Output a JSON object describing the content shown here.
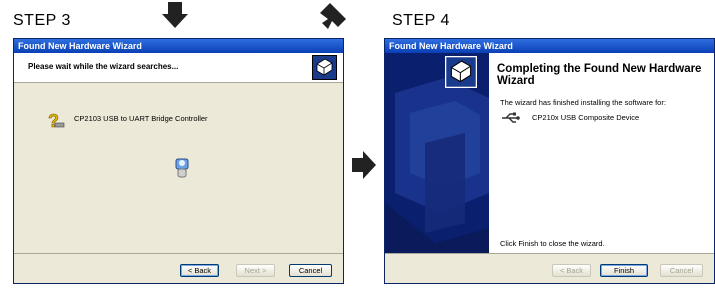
{
  "steps": {
    "left": "STEP 3",
    "right": "STEP 4"
  },
  "wizard_search": {
    "title": "Found New Hardware Wizard",
    "header": "Please wait while the wizard searches...",
    "device": "CP2103 USB to UART Bridge Controller",
    "buttons": {
      "back": "< Back",
      "next": "Next >",
      "cancel": "Cancel"
    }
  },
  "wizard_complete": {
    "title": "Found New Hardware Wizard",
    "heading": "Completing the Found New Hardware Wizard",
    "message": "The wizard has finished installing the software for:",
    "device": "CP210x USB Composite Device",
    "finish_note": "Click Finish to close the wizard.",
    "buttons": {
      "back": "< Back",
      "finish": "Finish",
      "cancel": "Cancel"
    }
  },
  "icons": [
    "down-arrow-icon",
    "diagonal-arrow-icon",
    "right-arrow-icon",
    "hardware-wizard-icon",
    "question-hardware-icon",
    "search-flashlight-icon",
    "usb-icon"
  ],
  "colors": {
    "titlebar": "#0a3fb5",
    "dialog_bg": "#ece9d8",
    "wizard_panel": "#0b1f6f"
  }
}
